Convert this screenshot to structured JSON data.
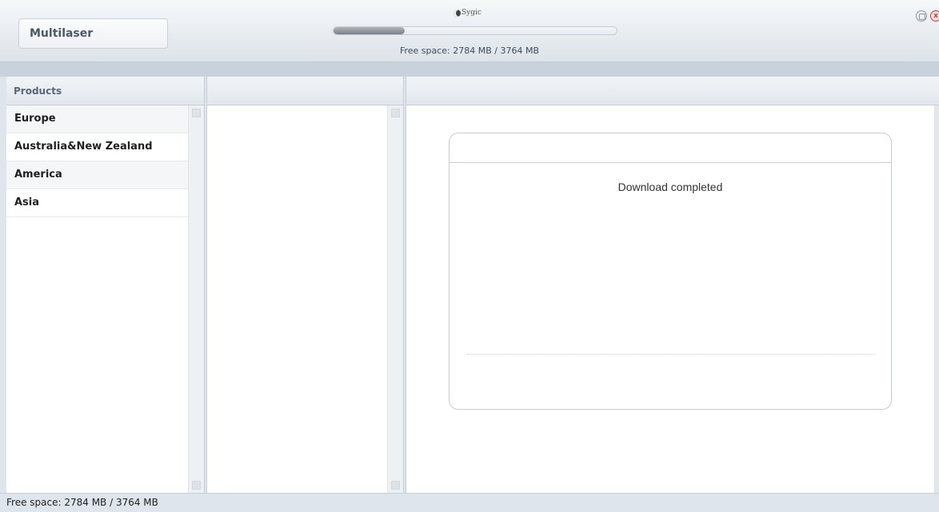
{
  "header": {
    "device_name": "Multilaser",
    "logo_text": "Sygic",
    "progress_fraction": 0.25,
    "free_space": "Free space: 2784 MB / 3764 MB"
  },
  "window_controls": {
    "minimize_icon": "minimize-icon",
    "close_icon": "close-icon",
    "close_glyph": "x"
  },
  "products_panel": {
    "title": "Products",
    "items": [
      {
        "label": "Europe"
      },
      {
        "label": "Australia&New Zealand"
      },
      {
        "label": "America"
      },
      {
        "label": "Asia"
      }
    ]
  },
  "dialog": {
    "message": "Download completed"
  },
  "footer": {
    "free_space": "Free space: 2784 MB / 3764 MB"
  }
}
